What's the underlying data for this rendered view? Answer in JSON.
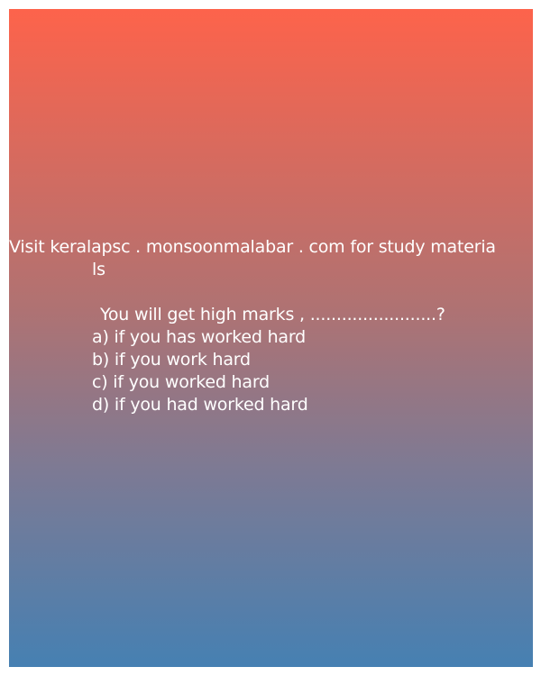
{
  "header": {
    "line1": "Visit keralapsc . monsoonmalabar . com for study materia",
    "line2": "ls"
  },
  "question": {
    "text": "You will get high marks , ........................?",
    "options": [
      "a) if you has worked hard",
      "b) if you work hard",
      "c) if you worked hard",
      "d) if you had worked hard"
    ]
  },
  "colors": {
    "gradient_top": "#fd634b",
    "gradient_bottom": "#4680b2",
    "text": "#ffffff"
  }
}
